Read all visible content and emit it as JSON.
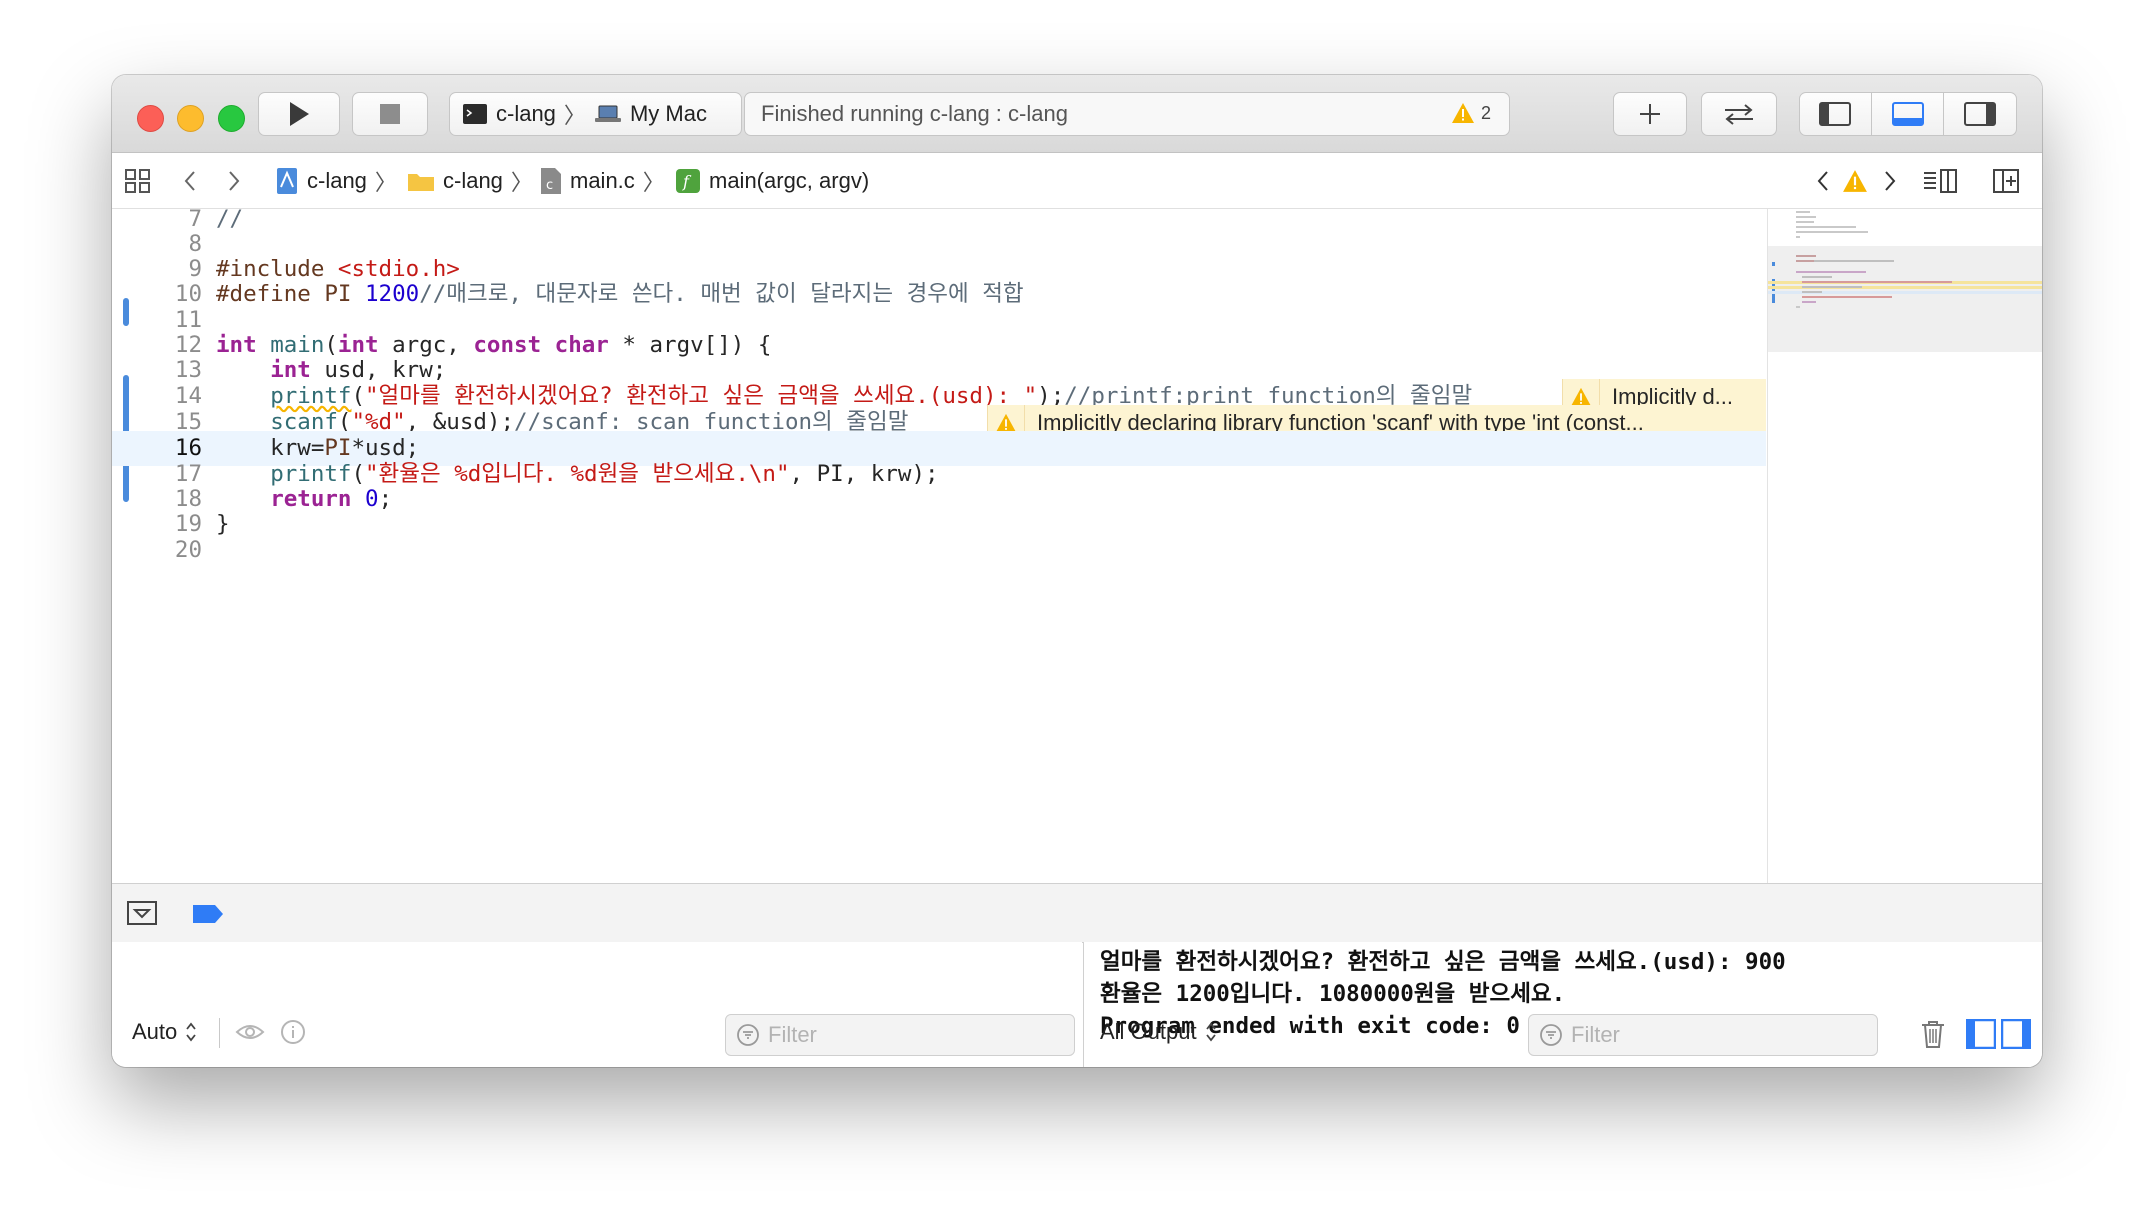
{
  "toolbar": {
    "scheme_name": "c-lang",
    "destination": "My Mac",
    "activity_text": "Finished running c-lang : c-lang",
    "warning_count": "2"
  },
  "jumpbar": {
    "project": "c-lang",
    "folder": "c-lang",
    "file": "main.c",
    "symbol": "main(argc, argv)"
  },
  "editor": {
    "lines": [
      {
        "num": "7"
      },
      {
        "num": "8"
      },
      {
        "num": "9"
      },
      {
        "num": "10"
      },
      {
        "num": "11"
      },
      {
        "num": "12"
      },
      {
        "num": "13"
      },
      {
        "num": "14"
      },
      {
        "num": "15"
      },
      {
        "num": "16"
      },
      {
        "num": "17"
      },
      {
        "num": "18"
      },
      {
        "num": "19"
      },
      {
        "num": "20"
      }
    ],
    "current_line": "16",
    "warning_printf": "Implicitly d...",
    "warning_scanf": "Implicitly declaring library function 'scanf' with type 'int (const..."
  },
  "debug": {
    "variables_scope": "Auto",
    "variables_filter_placeholder": "Filter",
    "console_scope": "All Output",
    "console_filter_placeholder": "Filter",
    "console_lines": [
      "얼마를 환전하시겠어요? 환전하고 싶은 금액을 쓰세요.(usd): 900",
      "환율은 1200입니다. 1080000원을 받으세요.",
      "Program ended with exit code: 0"
    ]
  },
  "colors": {
    "accent": "#2f7cf6",
    "keyword": "#9b2393",
    "string": "#c41a16",
    "number": "#1c00cf",
    "comment": "#5d6c79",
    "warning_bg": "#fdf4d2"
  }
}
